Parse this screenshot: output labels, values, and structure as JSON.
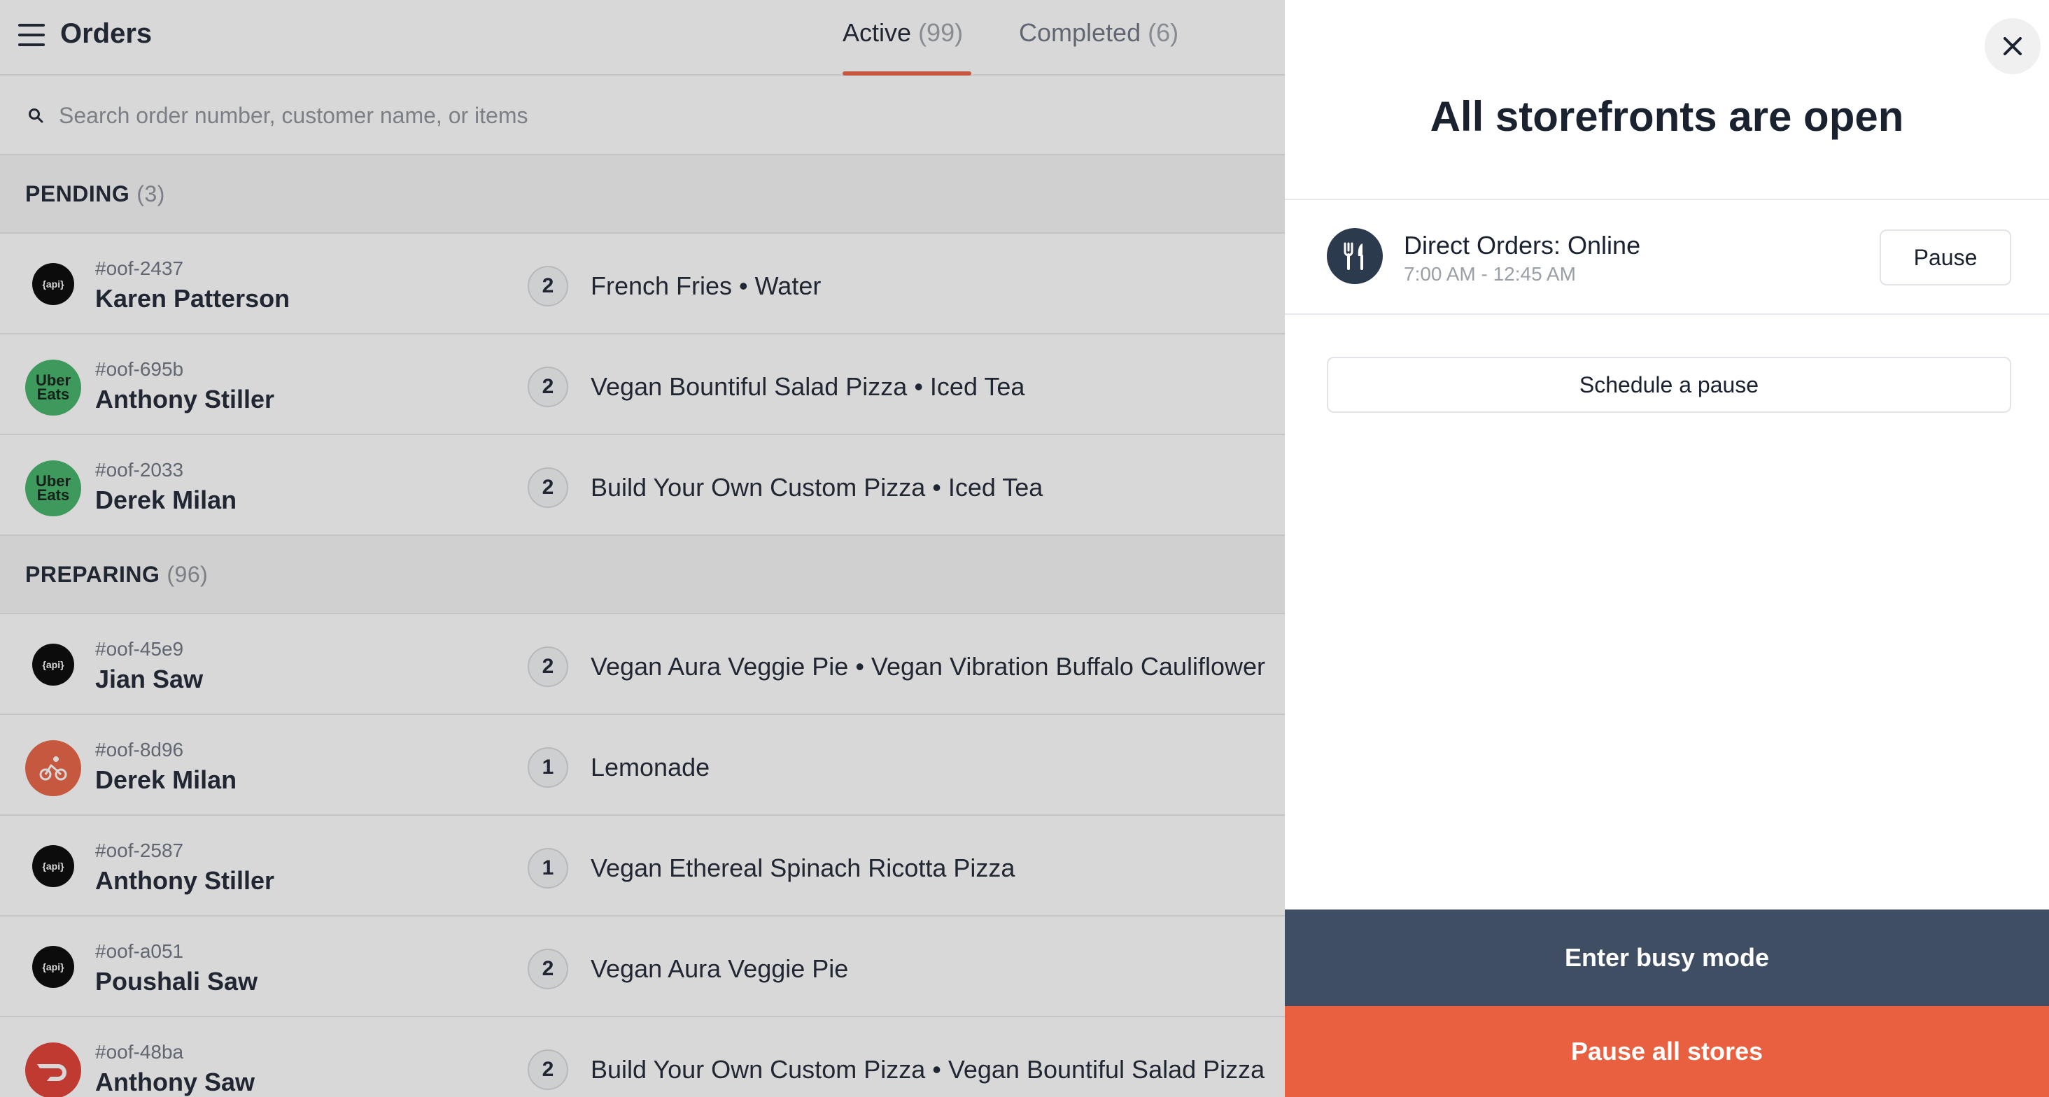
{
  "header": {
    "title": "Orders",
    "tabs": [
      {
        "label": "Active",
        "count": "(99)",
        "active": true
      },
      {
        "label": "Completed",
        "count": "(6)",
        "active": false
      }
    ]
  },
  "search": {
    "placeholder": "Search order number, customer name, or items",
    "value": ""
  },
  "sections": [
    {
      "label": "PENDING",
      "count": "(3)",
      "orders": [
        {
          "source": "api",
          "source_icon": "api-logo-icon",
          "id": "#oof-2437",
          "customer": "Karen Patterson",
          "qty": "2",
          "items": "French Fries • Water"
        },
        {
          "source": "uber-eats",
          "source_icon": "uber-eats-logo-icon",
          "id": "#oof-695b",
          "customer": "Anthony Stiller",
          "qty": "2",
          "items": "Vegan Bountiful Salad Pizza • Iced Tea"
        },
        {
          "source": "uber-eats",
          "source_icon": "uber-eats-logo-icon",
          "id": "#oof-2033",
          "customer": "Derek Milan",
          "qty": "2",
          "items": "Build Your Own Custom Pizza • Iced Tea"
        }
      ]
    },
    {
      "label": "PREPARING",
      "count": "(96)",
      "orders": [
        {
          "source": "api",
          "source_icon": "api-logo-icon",
          "id": "#oof-45e9",
          "customer": "Jian Saw",
          "qty": "2",
          "items": "Vegan Aura Veggie Pie • Vegan Vibration Buffalo Cauliflower"
        },
        {
          "source": "bike",
          "source_icon": "courier-bike-icon",
          "id": "#oof-8d96",
          "customer": "Derek Milan",
          "qty": "1",
          "items": "Lemonade"
        },
        {
          "source": "api",
          "source_icon": "api-logo-icon",
          "id": "#oof-2587",
          "customer": "Anthony Stiller",
          "qty": "1",
          "items": "Vegan Ethereal Spinach Ricotta Pizza"
        },
        {
          "source": "api",
          "source_icon": "api-logo-icon",
          "id": "#oof-a051",
          "customer": "Poushali Saw",
          "qty": "2",
          "items": "Vegan Aura Veggie Pie"
        },
        {
          "source": "doordash",
          "source_icon": "doordash-logo-icon",
          "id": "#oof-48ba",
          "customer": "Anthony Saw",
          "qty": "2",
          "items": "Build Your Own Custom Pizza • Vegan Bountiful Salad Pizza"
        }
      ]
    }
  ],
  "api_logo_text": "{api}",
  "uber_logo_text": [
    "Uber",
    "Eats"
  ],
  "panel": {
    "title": "All storefronts are open",
    "store": {
      "icon": "fork-knife-icon",
      "name": "Direct Orders: Online",
      "hours": "7:00 AM - 12:45 AM",
      "pause_label": "Pause"
    },
    "schedule_label": "Schedule a pause",
    "busy_label": "Enter busy mode",
    "pause_all_label": "Pause all stores"
  },
  "colors": {
    "accent": "#e8603f",
    "busy": "#3f4e62",
    "store_icon_bg": "#2c3a4e",
    "uber_green": "#3fb264",
    "doordash_red": "#e03a2f"
  }
}
